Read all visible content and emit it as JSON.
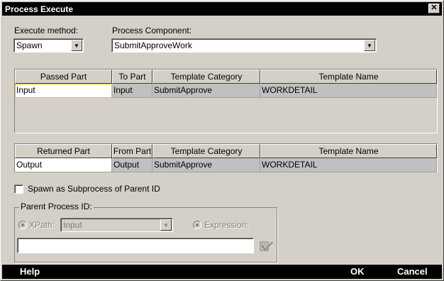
{
  "window": {
    "title": "Process Execute"
  },
  "execute_method": {
    "label": "Execute method:",
    "value": "Spawn"
  },
  "process_component": {
    "label": "Process Component:",
    "value": "SubmitApproveWork"
  },
  "passed_table": {
    "headers": [
      "Passed Part",
      "To Part",
      "Template Category",
      "Template Name"
    ],
    "rows": [
      [
        "Input",
        "Input",
        "SubmitApprove",
        "WORKDETAIL"
      ]
    ]
  },
  "returned_table": {
    "headers": [
      "Returned Part",
      "From Part",
      "Template Category",
      "Template Name"
    ],
    "rows": [
      [
        "Output",
        "Output",
        "SubmitApprove",
        "WORKDETAIL"
      ]
    ]
  },
  "spawn_subprocess": {
    "label": "Spawn as Subprocess of Parent ID",
    "checked": false
  },
  "parent_process": {
    "title": "Parent Process ID:",
    "xpath_label": "XPath:",
    "xpath_value": "Input",
    "expression_label": "Expression:",
    "value": ""
  },
  "footer": {
    "help": "Help",
    "ok": "OK",
    "cancel": "Cancel"
  }
}
